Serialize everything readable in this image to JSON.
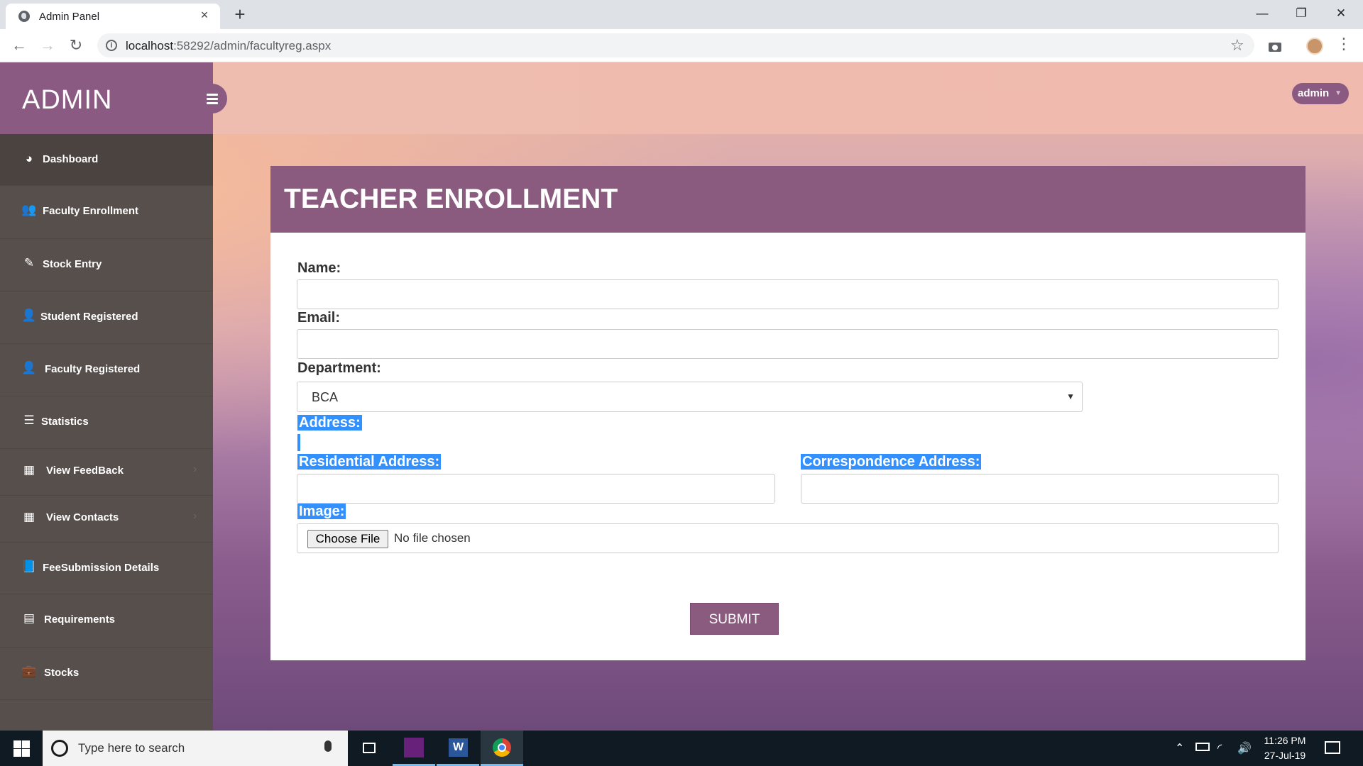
{
  "browser": {
    "tab_title": "Admin Panel",
    "tab_close": "×",
    "new_tab": "+",
    "url_host": "localhost",
    "url_rest": ":58292/admin/facultyreg.aspx",
    "window_controls": {
      "minimize": "—",
      "maximize": "❐",
      "close": "✕"
    },
    "nav": {
      "back": "←",
      "forward": "→",
      "reload": "↻"
    },
    "star": "☆",
    "menu": "⋮"
  },
  "sidebar": {
    "brand": "ADMIN",
    "items": [
      {
        "label": "Dashboard",
        "icon": "dashboard-icon",
        "glyph": "◕"
      },
      {
        "label": "Faculty Enrollment",
        "icon": "users-icon",
        "glyph": "👥"
      },
      {
        "label": "Stock Entry",
        "icon": "edit-icon",
        "glyph": "✎"
      },
      {
        "label": "Student Registered",
        "icon": "user-icon",
        "glyph": "👤"
      },
      {
        "label": "Faculty Registered",
        "icon": "user-plus-icon",
        "glyph": "👤"
      },
      {
        "label": "Statistics",
        "icon": "list-icon",
        "glyph": "☰"
      },
      {
        "label": "View FeedBack",
        "icon": "grid-icon",
        "glyph": "▦"
      },
      {
        "label": "View Contacts",
        "icon": "grid-icon",
        "glyph": "▦"
      },
      {
        "label": "FeeSubmission Details",
        "icon": "book-icon",
        "glyph": "📘"
      },
      {
        "label": "Requirements",
        "icon": "server-icon",
        "glyph": "▤"
      },
      {
        "label": "Stocks",
        "icon": "briefcase-icon",
        "glyph": "💼"
      }
    ],
    "chevron": "›"
  },
  "topbar": {
    "user": "admin",
    "caret": "▼"
  },
  "form": {
    "title": "TEACHER ENROLLMENT",
    "name_label": "Name:",
    "email_label": "Email:",
    "department_label": "Department:",
    "department_value": "BCA",
    "select_arrow": "▼",
    "address_label": "Address:",
    "residential_label": "Residential Address:",
    "correspondence_label": "Correspondence Address:",
    "image_label": "Image:",
    "file_button": "Choose File",
    "file_status": "No file chosen",
    "submit": "SUBMIT"
  },
  "taskbar": {
    "search_placeholder": "Type here to search",
    "time": "11:26 PM",
    "date": "27-Jul-19"
  }
}
